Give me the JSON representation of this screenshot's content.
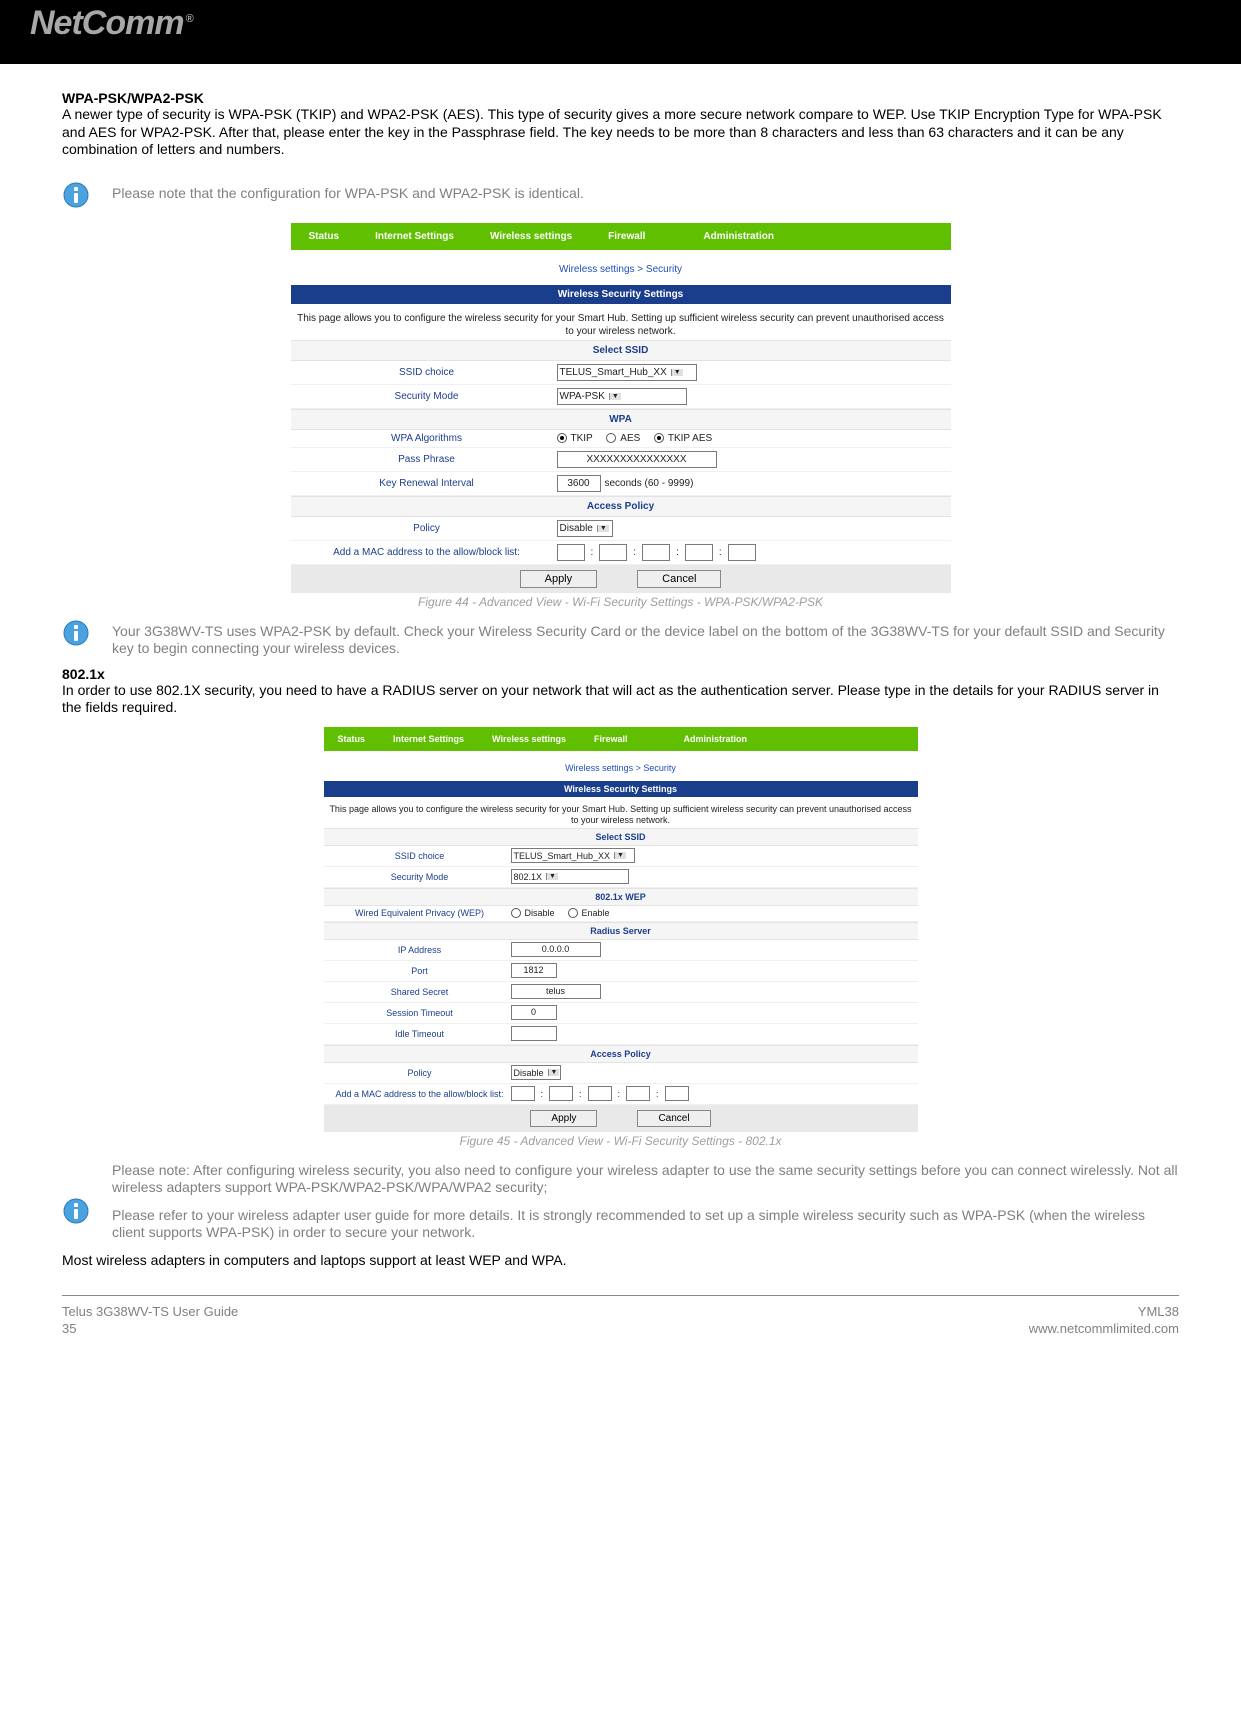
{
  "brand": "NetComm",
  "section1": {
    "title": "WPA-PSK/WPA2-PSK",
    "body": "A newer type of security is WPA-PSK (TKIP) and WPA2-PSK (AES). This type of security gives a more secure network compare to WEP. Use TKIP Encryption Type for WPA-PSK and AES for WPA2-PSK. After that, please enter the key in the Passphrase field. The key needs to be more than 8 characters and less than 63 characters and it can be any combination of letters and numbers."
  },
  "note1": "Please note that the configuration for WPA-PSK and WPA2-PSK is identical.",
  "panel1": {
    "tabs": [
      "Status",
      "Internet Settings",
      "Wireless settings",
      "Firewall",
      "Administration"
    ],
    "breadcrumb": "Wireless settings > Security",
    "band_title": "Wireless Security Settings",
    "band_desc": "This page allows you to configure the wireless security for your Smart Hub. Setting up sufficient wireless security can prevent unauthorised access to your wireless network.",
    "section_ssid": "Select SSID",
    "ssid_label": "SSID choice",
    "ssid_value": "TELUS_Smart_Hub_XX",
    "secmode_label": "Security Mode",
    "secmode_value": "WPA-PSK",
    "section_wpa": "WPA",
    "wpaalg_label": "WPA Algorithms",
    "wpaalg_opts": [
      "TKIP",
      "AES",
      "TKIP AES"
    ],
    "pass_label": "Pass Phrase",
    "pass_value": "XXXXXXXXXXXXXXX",
    "keyren_label": "Key Renewal Interval",
    "keyren_value": "3600",
    "keyren_suffix": "seconds (60 - 9999)",
    "section_policy": "Access Policy",
    "policy_label": "Policy",
    "policy_value": "Disable",
    "mac_label": "Add a MAC address to the allow/block list:",
    "apply": "Apply",
    "cancel": "Cancel",
    "caption": "Figure 44 - Advanced View - Wi-Fi Security Settings - WPA-PSK/WPA2-PSK"
  },
  "note2": "Your 3G38WV-TS uses WPA2-PSK by default. Check your Wireless Security Card or the device label on the bottom of the 3G38WV-TS for your default SSID and Security key to begin connecting your wireless devices.",
  "section2": {
    "title": "802.1x",
    "body": "In order to use 802.1X security, you need to have a RADIUS server on your network that will act as the authentication server. Please type in the details for your RADIUS server in the fields required."
  },
  "panel2": {
    "tabs": [
      "Status",
      "Internet Settings",
      "Wireless settings",
      "Firewall",
      "Administration"
    ],
    "breadcrumb": "Wireless settings > Security",
    "band_title": "Wireless Security Settings",
    "band_desc": "This page allows you to configure the wireless security for your Smart Hub. Setting up sufficient wireless security can prevent unauthorised access to your wireless network.",
    "section_ssid": "Select SSID",
    "ssid_label": "SSID choice",
    "ssid_value": "TELUS_Smart_Hub_XX",
    "secmode_label": "Security Mode",
    "secmode_value": "802.1X",
    "section_wep": "802.1x WEP",
    "wep_label": "Wired Equivalent Privacy (WEP)",
    "wep_opts": [
      "Disable",
      "Enable"
    ],
    "section_radius": "Radius Server",
    "ip_label": "IP Address",
    "ip_value": "0.0.0.0",
    "port_label": "Port",
    "port_value": "1812",
    "secret_label": "Shared Secret",
    "secret_value": "telus",
    "sess_label": "Session Timeout",
    "sess_value": "0",
    "idle_label": "Idle Timeout",
    "idle_value": "",
    "section_policy": "Access Policy",
    "policy_label": "Policy",
    "policy_value": "Disable",
    "mac_label": "Add a MAC address to the allow/block list:",
    "apply": "Apply",
    "cancel": "Cancel",
    "caption": "Figure 45 - Advanced View - Wi-Fi Security Settings - 802.1x"
  },
  "note3a": "Please note: After configuring wireless security, you also need to configure your wireless adapter to use the same security settings before you can connect wirelessly. Not all wireless adapters support WPA-PSK/WPA2-PSK/WPA/WPA2 security;",
  "note3b": "Please refer to your wireless adapter user guide for more details. It is strongly recommended to set up a simple wireless security such as WPA-PSK (when the wireless client supports WPA-PSK) in order to secure your network.",
  "closing": "Most wireless adapters in computers and laptops support at least WEP and WPA.",
  "footer": {
    "left_line1": "Telus 3G38WV-TS User Guide",
    "left_line2": "35",
    "right_line1": "YML38",
    "right_line2": "www.netcommlimited.com"
  }
}
